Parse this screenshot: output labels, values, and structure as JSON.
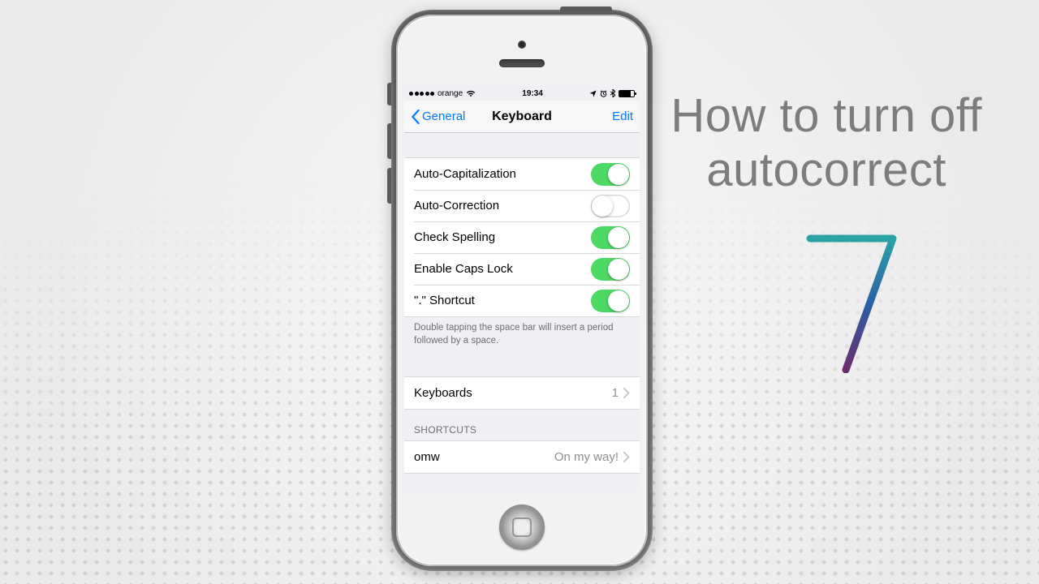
{
  "headline": {
    "line1": "How to turn off",
    "line2": "autocorrect"
  },
  "statusbar": {
    "carrier": "orange",
    "time": "19:34"
  },
  "nav": {
    "back": "General",
    "title": "Keyboard",
    "edit": "Edit"
  },
  "toggles": [
    {
      "label": "Auto-Capitalization",
      "on": true
    },
    {
      "label": "Auto-Correction",
      "on": false
    },
    {
      "label": "Check Spelling",
      "on": true
    },
    {
      "label": "Enable Caps Lock",
      "on": true
    },
    {
      "label": "\".\" Shortcut",
      "on": true
    }
  ],
  "footer_note": "Double tapping the space bar will insert a period followed by a space.",
  "keyboards": {
    "label": "Keyboards",
    "count": "1"
  },
  "shortcuts": {
    "header": "SHORTCUTS",
    "items": [
      {
        "key": "omw",
        "value": "On my way!"
      }
    ]
  }
}
